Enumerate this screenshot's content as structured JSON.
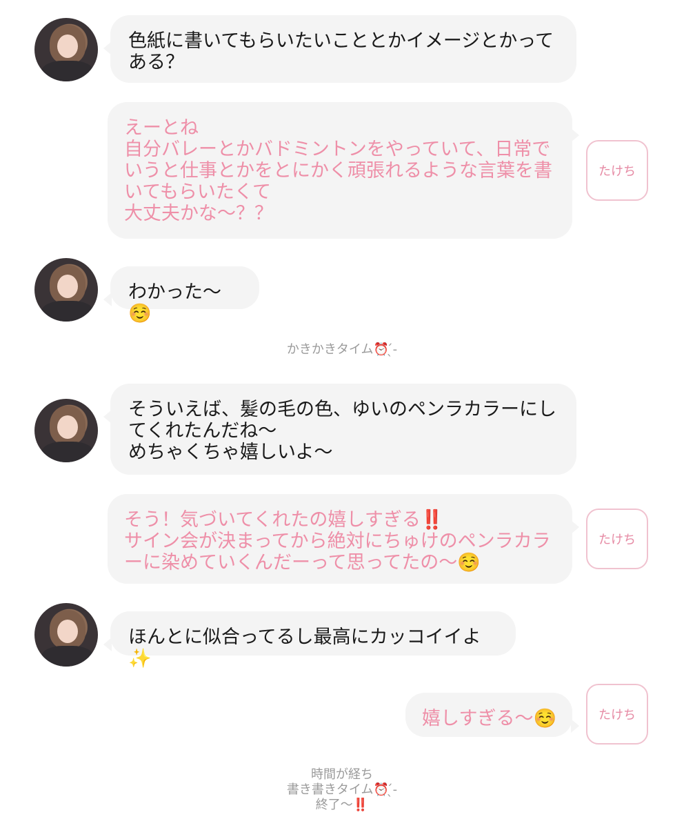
{
  "messages": [
    {
      "sender": "other",
      "text": "色紙に書いてもらいたいこととかイメージとかって\nある？"
    },
    {
      "sender": "me",
      "text": "えーとね\n自分バレーとかバドミントンをやっていて、日常で\nいうと仕事とかをとにかく頑張れるような言葉を書\nいてもらいたくて\n大丈夫かな〜？？"
    },
    {
      "sender": "other",
      "text": "わかった〜☺️"
    },
    {
      "sender": "system",
      "text": "かきかきタイム⏰ ̖́-"
    },
    {
      "sender": "other",
      "text": "そういえば、髪の毛の色、ゆいのペンラカラーにし\nてくれたんだね〜\nめちゃくちゃ嬉しいよ〜"
    },
    {
      "sender": "me",
      "text": "そう！気づいてくれたの嬉しすぎる‼️\nサイン会が決まってから絶対にちゅけのペンラカラ\nーに染めていくんだーって思ってたの〜☺️"
    },
    {
      "sender": "other",
      "text": "ほんとに似合ってるし最高にカッコイイよ✨"
    },
    {
      "sender": "me",
      "text": "嬉しすぎる〜☺️"
    },
    {
      "sender": "system",
      "text": "時間が経ち\n書き書きタイム⏰ ̖́-\n終了〜‼️"
    }
  ],
  "me_label": "たけち"
}
